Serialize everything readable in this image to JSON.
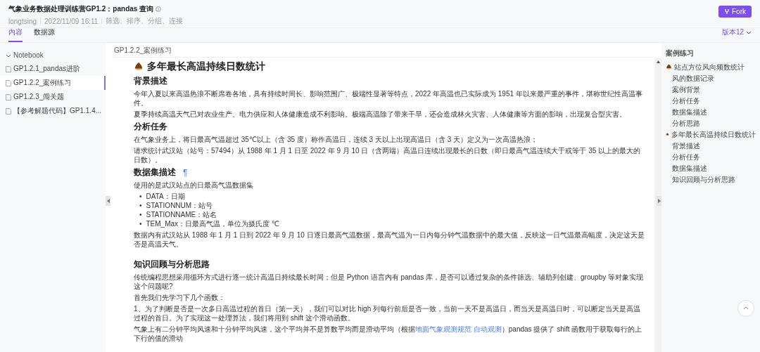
{
  "header": {
    "title": "气象业务数据处理训练营GP1.2：pandas 查询",
    "meta": [
      "longtsing",
      "2022/11/09 16:11",
      "筛选、排序、分组、连接"
    ],
    "fork_button": "Fork"
  },
  "tabs": [
    {
      "label": "内容",
      "selected": true
    },
    {
      "label": "数据源",
      "selected": false
    }
  ],
  "version_select": "版本12",
  "sidebar": {
    "label": "Notebook",
    "expanded": true,
    "children": [
      {
        "label": "GP1.2.1_pandas进阶",
        "selected": false
      },
      {
        "label": "GP1.2.2_案例练习",
        "selected": true
      },
      {
        "label": "GP1.2.3_闯关题",
        "selected": false
      },
      {
        "label": "【参考解题代码】GP1.1.4...",
        "selected": false
      }
    ]
  },
  "breadcrumb": "GP1.2.2_案例练习",
  "document": [
    {
      "kind": "title",
      "text": "多年最长高温持续日数统计"
    },
    {
      "kind": "heading",
      "text": "背景描述"
    },
    {
      "kind": "paragraph",
      "text": "今年入夏以来高温热浪不断席卷各地，具有持续时间长、影响范围广、极端性显著等特点，2022 年高温也已实际成为 1951 年以来最严重的事件，堪称世纪性高温事件。"
    },
    {
      "kind": "paragraph",
      "text": "夏季持续高温天气已对农业生产、电力供应和人体健康造成不利影响。极端高温除了带来干旱，还会造成林火灾害、人体健康等方面的影响，出现复合型灾害。"
    },
    {
      "kind": "heading",
      "text": "分析任务"
    },
    {
      "kind": "paragraph",
      "text": "在气象业务上，将日最高气温超过 35℃以上（含 35 度）称作高温日，连续 3 天以上出现高温日（含 3 天）定义为一次高温热浪；"
    },
    {
      "kind": "paragraph",
      "text": "请求统计武汉站（站号：57494）从 1988 年 1 月 1 日至 2022 年 9 月 10 日（含两端）高温日连续出现最长的日数（即日最高气温连续大于或等于 35 以上的最大的日数）。"
    },
    {
      "kind": "heading",
      "text": "数据集描述",
      "anchor": "¶"
    },
    {
      "kind": "paragraph",
      "text": "使用的是武汉站点的日最高气温数据集"
    },
    {
      "kind": "list",
      "marker": "•",
      "items": [
        "DATA：日期",
        "STATIONNUM：站号",
        "STATIONNAME：站名",
        "TEM_Max：日最高气温，单位为摄氏度 ℃"
      ]
    },
    {
      "kind": "paragraph",
      "text": "数据内有武汉站从 1988 年 1 月 1 日到 2022 年 9 月 10 日逐日最高气温数据，最高气温为一日内每分钟气温数据中的最大值，反映这一日气温最高幅度，决定这天是否是高温天气。"
    },
    {
      "kind": "spacer"
    },
    {
      "kind": "heading",
      "text": "知识回顾与分析思路"
    },
    {
      "kind": "paragraph",
      "text": "传统编程思想采用循环方式进行逐一统计高温日持续最长时间；但是 Python 语言内有 pandas 库，是否可以通过复杂的条件筛选、辅助列创建、groupby 等对象实现这个问题呢?"
    },
    {
      "kind": "paragraph",
      "text": "首先我们先学习下几个函数："
    },
    {
      "kind": "paragraph",
      "text": "1、为了判断是否是一次多日高温过程的首日（第一天），我们可以对比 high 列每行前后是否一致，当前一天不是高温日，而当天是高温日时，可以断定当天是高温过程的首日。为了实现这一处理算法，我们将用到 shift 这个滑动函数。"
    },
    {
      "kind": "paragraph",
      "text": "气象上有二分钟平均风速和十分钟平均风速，这个平均并不是算数平均而是滑动平均（根据",
      "link": "地面气象观测规范 自动观测",
      "after": "）pandas 提供了 shift 函数用于获取每行的上下行的值的滑动"
    }
  ],
  "toc": {
    "title": "案例练习",
    "items": [
      {
        "label": "站点方位风向频数统计",
        "children": [
          {
            "label": "风的数据记录"
          },
          {
            "label": "案例背景"
          },
          {
            "label": "分析任务"
          },
          {
            "label": "数据集描述"
          },
          {
            "label": "分析思路"
          }
        ]
      },
      {
        "label": "多年最长高温持续日数统计",
        "children": [
          {
            "label": "背景描述"
          },
          {
            "label": "分析任务"
          },
          {
            "label": "数据集描述"
          },
          {
            "label": "知识回顾与分析思路"
          }
        ]
      }
    ]
  }
}
